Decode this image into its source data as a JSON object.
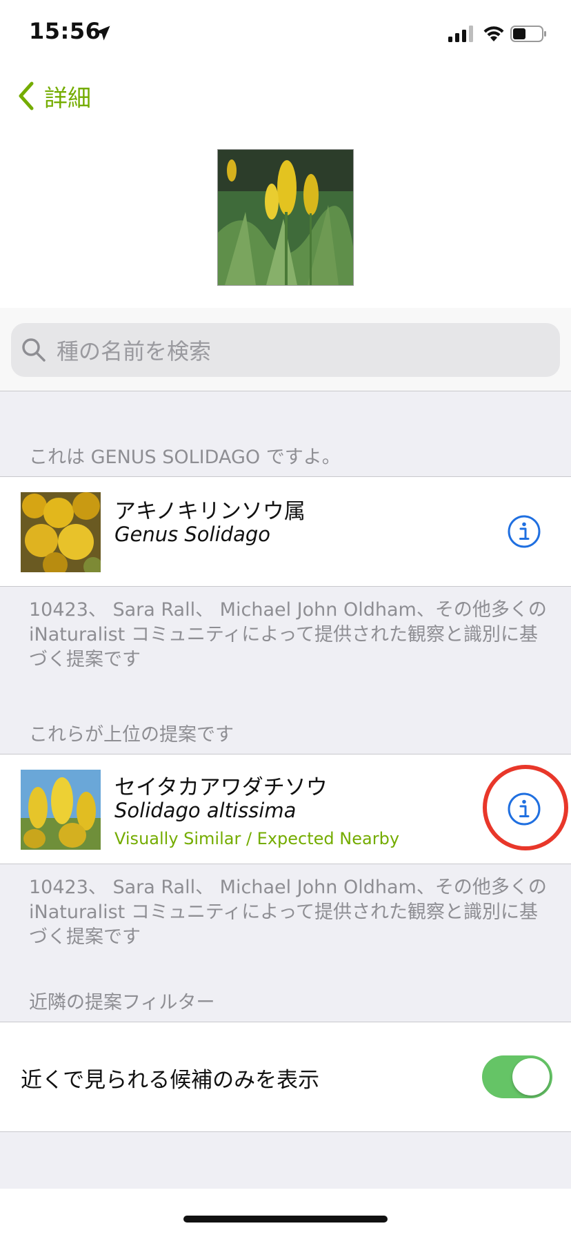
{
  "status_bar": {
    "time": "15:56"
  },
  "nav": {
    "back_label": "詳細"
  },
  "search": {
    "placeholder": "種の名前を検索"
  },
  "sections": {
    "genus_header": "これは GENUS SOLIDAGO ですよ。",
    "top_header": "これらが上位の提案です",
    "filter_header": "近隣の提案フィルター"
  },
  "genus_suggestion": {
    "common_name": "アキノキリンソウ属",
    "scientific_name": "Genus Solidago",
    "attribution": "10423、 Sara Rall、 Michael John Oldham、その他多くの iNaturalist コミュニティによって提供された観察と識別に基づく提案です"
  },
  "top_suggestion": {
    "common_name": "セイタカアワダチソウ",
    "scientific_name": "Solidago altissima",
    "tag": "Visually Similar / Expected Nearby",
    "attribution": "10423、 Sara Rall、 Michael John Oldham、その他多くの iNaturalist コミュニティによって提供された観察と識別に基づく提案です"
  },
  "filter": {
    "label": "近くで見られる候補のみを表示",
    "enabled": true
  },
  "colors": {
    "accent": "#74ac00",
    "info_blue": "#1f6fe0",
    "toggle_on": "#65c466",
    "highlight": "#e8372a"
  }
}
